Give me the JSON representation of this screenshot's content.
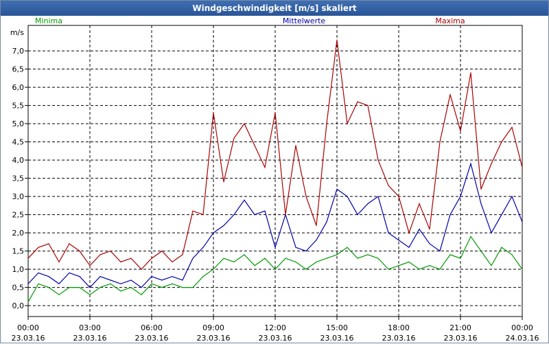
{
  "window": {
    "title": "Windgeschwindigkeit [m/s] skaliert"
  },
  "chart_data": {
    "type": "line",
    "title": "Windgeschwindigkeit [m/s] skaliert",
    "ylabel": "m/s",
    "ylim": [
      -0.3,
      7.7
    ],
    "yticks": [
      "0,0",
      "0,5",
      "1,0",
      "1,5",
      "2,0",
      "2,5",
      "3,0",
      "3,5",
      "4,0",
      "4,5",
      "5,0",
      "5,5",
      "6,0",
      "6,5",
      "7,0"
    ],
    "xlim": [
      0,
      24
    ],
    "xticks": [
      {
        "time": "00:00",
        "date": "23.03.16"
      },
      {
        "time": "03:00",
        "date": "23.03.16"
      },
      {
        "time": "06:00",
        "date": "23.03.16"
      },
      {
        "time": "09:00",
        "date": "23.03.16"
      },
      {
        "time": "12:00",
        "date": "23.03.16"
      },
      {
        "time": "15:00",
        "date": "23.03.16"
      },
      {
        "time": "18:00",
        "date": "23.03.16"
      },
      {
        "time": "21:00",
        "date": "23.03.16"
      },
      {
        "time": "00:00",
        "date": "24.03.16"
      }
    ],
    "grid": true,
    "legend_position": "top",
    "series": [
      {
        "name": "Minima",
        "color": "#009a00",
        "x": [
          0,
          0.5,
          1,
          1.5,
          2,
          2.5,
          3,
          3.5,
          4,
          4.5,
          5,
          5.5,
          6,
          6.5,
          7,
          7.5,
          8,
          8.5,
          9,
          9.5,
          10,
          10.5,
          11,
          11.5,
          12,
          12.5,
          13,
          13.5,
          14,
          14.5,
          15,
          15.5,
          16,
          16.5,
          17,
          17.5,
          18,
          18.5,
          19,
          19.5,
          20,
          20.5,
          21,
          21.5,
          22,
          22.5,
          23,
          23.5,
          24
        ],
        "values": [
          0.1,
          0.6,
          0.5,
          0.3,
          0.5,
          0.5,
          0.3,
          0.5,
          0.6,
          0.4,
          0.5,
          0.3,
          0.6,
          0.5,
          0.6,
          0.5,
          0.5,
          0.8,
          1.0,
          1.3,
          1.2,
          1.4,
          1.1,
          1.3,
          1.0,
          1.3,
          1.2,
          1.0,
          1.2,
          1.3,
          1.4,
          1.6,
          1.3,
          1.4,
          1.3,
          1.0,
          1.1,
          1.2,
          1.0,
          1.1,
          1.0,
          1.4,
          1.3,
          1.9,
          1.5,
          1.1,
          1.6,
          1.4,
          1.0
        ]
      },
      {
        "name": "Mittelwerte",
        "color": "#0000aa",
        "x": [
          0,
          0.5,
          1,
          1.5,
          2,
          2.5,
          3,
          3.5,
          4,
          4.5,
          5,
          5.5,
          6,
          6.5,
          7,
          7.5,
          8,
          8.5,
          9,
          9.5,
          10,
          10.5,
          11,
          11.5,
          12,
          12.5,
          13,
          13.5,
          14,
          14.5,
          15,
          15.5,
          16,
          16.5,
          17,
          17.5,
          18,
          18.5,
          19,
          19.5,
          20,
          20.5,
          21,
          21.5,
          22,
          22.5,
          23,
          23.5,
          24
        ],
        "values": [
          0.6,
          0.9,
          0.8,
          0.6,
          0.9,
          0.8,
          0.5,
          0.8,
          0.7,
          0.6,
          0.7,
          0.5,
          0.8,
          0.7,
          0.8,
          0.7,
          1.3,
          1.6,
          2.0,
          2.2,
          2.5,
          2.9,
          2.5,
          2.6,
          1.6,
          2.5,
          1.6,
          1.5,
          1.8,
          2.3,
          3.2,
          3.0,
          2.5,
          2.8,
          3.0,
          2.0,
          1.8,
          1.6,
          2.1,
          1.7,
          1.5,
          2.5,
          3.0,
          3.9,
          2.8,
          2.0,
          2.5,
          3.0,
          2.3
        ]
      },
      {
        "name": "Maxima",
        "color": "#aa0000",
        "x": [
          0,
          0.5,
          1,
          1.5,
          2,
          2.5,
          3,
          3.5,
          4,
          4.5,
          5,
          5.5,
          6,
          6.5,
          7,
          7.5,
          8,
          8.5,
          9,
          9.5,
          10,
          10.5,
          11,
          11.5,
          12,
          12.5,
          13,
          13.5,
          14,
          14.5,
          15,
          15.5,
          16,
          16.5,
          17,
          17.5,
          18,
          18.5,
          19,
          19.5,
          20,
          20.5,
          21,
          21.5,
          22,
          22.5,
          23,
          23.5,
          24
        ],
        "values": [
          1.3,
          1.6,
          1.7,
          1.2,
          1.7,
          1.5,
          1.1,
          1.4,
          1.5,
          1.2,
          1.3,
          1.0,
          1.3,
          1.5,
          1.2,
          1.4,
          2.6,
          2.5,
          5.3,
          3.4,
          4.6,
          5.0,
          4.4,
          3.8,
          5.3,
          2.5,
          4.4,
          3.0,
          2.2,
          5.0,
          7.3,
          5.0,
          5.6,
          5.5,
          4.0,
          3.3,
          3.0,
          2.0,
          2.8,
          2.1,
          4.5,
          5.8,
          4.8,
          6.4,
          3.2,
          3.9,
          4.5,
          4.9,
          3.8
        ]
      }
    ]
  }
}
